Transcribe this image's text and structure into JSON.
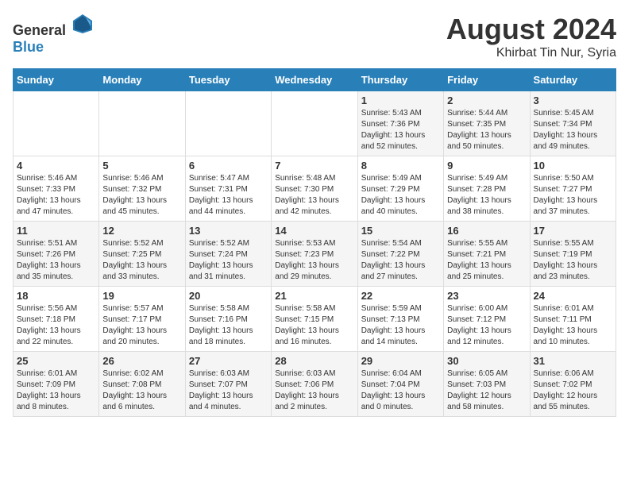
{
  "header": {
    "logo_general": "General",
    "logo_blue": "Blue",
    "title": "August 2024",
    "subtitle": "Khirbat Tin Nur, Syria"
  },
  "weekdays": [
    "Sunday",
    "Monday",
    "Tuesday",
    "Wednesday",
    "Thursday",
    "Friday",
    "Saturday"
  ],
  "weeks": [
    [
      {
        "day": "",
        "sunrise": "",
        "sunset": "",
        "daylight": ""
      },
      {
        "day": "",
        "sunrise": "",
        "sunset": "",
        "daylight": ""
      },
      {
        "day": "",
        "sunrise": "",
        "sunset": "",
        "daylight": ""
      },
      {
        "day": "",
        "sunrise": "",
        "sunset": "",
        "daylight": ""
      },
      {
        "day": "1",
        "sunrise": "Sunrise: 5:43 AM",
        "sunset": "Sunset: 7:36 PM",
        "daylight": "Daylight: 13 hours and 52 minutes."
      },
      {
        "day": "2",
        "sunrise": "Sunrise: 5:44 AM",
        "sunset": "Sunset: 7:35 PM",
        "daylight": "Daylight: 13 hours and 50 minutes."
      },
      {
        "day": "3",
        "sunrise": "Sunrise: 5:45 AM",
        "sunset": "Sunset: 7:34 PM",
        "daylight": "Daylight: 13 hours and 49 minutes."
      }
    ],
    [
      {
        "day": "4",
        "sunrise": "Sunrise: 5:46 AM",
        "sunset": "Sunset: 7:33 PM",
        "daylight": "Daylight: 13 hours and 47 minutes."
      },
      {
        "day": "5",
        "sunrise": "Sunrise: 5:46 AM",
        "sunset": "Sunset: 7:32 PM",
        "daylight": "Daylight: 13 hours and 45 minutes."
      },
      {
        "day": "6",
        "sunrise": "Sunrise: 5:47 AM",
        "sunset": "Sunset: 7:31 PM",
        "daylight": "Daylight: 13 hours and 44 minutes."
      },
      {
        "day": "7",
        "sunrise": "Sunrise: 5:48 AM",
        "sunset": "Sunset: 7:30 PM",
        "daylight": "Daylight: 13 hours and 42 minutes."
      },
      {
        "day": "8",
        "sunrise": "Sunrise: 5:49 AM",
        "sunset": "Sunset: 7:29 PM",
        "daylight": "Daylight: 13 hours and 40 minutes."
      },
      {
        "day": "9",
        "sunrise": "Sunrise: 5:49 AM",
        "sunset": "Sunset: 7:28 PM",
        "daylight": "Daylight: 13 hours and 38 minutes."
      },
      {
        "day": "10",
        "sunrise": "Sunrise: 5:50 AM",
        "sunset": "Sunset: 7:27 PM",
        "daylight": "Daylight: 13 hours and 37 minutes."
      }
    ],
    [
      {
        "day": "11",
        "sunrise": "Sunrise: 5:51 AM",
        "sunset": "Sunset: 7:26 PM",
        "daylight": "Daylight: 13 hours and 35 minutes."
      },
      {
        "day": "12",
        "sunrise": "Sunrise: 5:52 AM",
        "sunset": "Sunset: 7:25 PM",
        "daylight": "Daylight: 13 hours and 33 minutes."
      },
      {
        "day": "13",
        "sunrise": "Sunrise: 5:52 AM",
        "sunset": "Sunset: 7:24 PM",
        "daylight": "Daylight: 13 hours and 31 minutes."
      },
      {
        "day": "14",
        "sunrise": "Sunrise: 5:53 AM",
        "sunset": "Sunset: 7:23 PM",
        "daylight": "Daylight: 13 hours and 29 minutes."
      },
      {
        "day": "15",
        "sunrise": "Sunrise: 5:54 AM",
        "sunset": "Sunset: 7:22 PM",
        "daylight": "Daylight: 13 hours and 27 minutes."
      },
      {
        "day": "16",
        "sunrise": "Sunrise: 5:55 AM",
        "sunset": "Sunset: 7:21 PM",
        "daylight": "Daylight: 13 hours and 25 minutes."
      },
      {
        "day": "17",
        "sunrise": "Sunrise: 5:55 AM",
        "sunset": "Sunset: 7:19 PM",
        "daylight": "Daylight: 13 hours and 23 minutes."
      }
    ],
    [
      {
        "day": "18",
        "sunrise": "Sunrise: 5:56 AM",
        "sunset": "Sunset: 7:18 PM",
        "daylight": "Daylight: 13 hours and 22 minutes."
      },
      {
        "day": "19",
        "sunrise": "Sunrise: 5:57 AM",
        "sunset": "Sunset: 7:17 PM",
        "daylight": "Daylight: 13 hours and 20 minutes."
      },
      {
        "day": "20",
        "sunrise": "Sunrise: 5:58 AM",
        "sunset": "Sunset: 7:16 PM",
        "daylight": "Daylight: 13 hours and 18 minutes."
      },
      {
        "day": "21",
        "sunrise": "Sunrise: 5:58 AM",
        "sunset": "Sunset: 7:15 PM",
        "daylight": "Daylight: 13 hours and 16 minutes."
      },
      {
        "day": "22",
        "sunrise": "Sunrise: 5:59 AM",
        "sunset": "Sunset: 7:13 PM",
        "daylight": "Daylight: 13 hours and 14 minutes."
      },
      {
        "day": "23",
        "sunrise": "Sunrise: 6:00 AM",
        "sunset": "Sunset: 7:12 PM",
        "daylight": "Daylight: 13 hours and 12 minutes."
      },
      {
        "day": "24",
        "sunrise": "Sunrise: 6:01 AM",
        "sunset": "Sunset: 7:11 PM",
        "daylight": "Daylight: 13 hours and 10 minutes."
      }
    ],
    [
      {
        "day": "25",
        "sunrise": "Sunrise: 6:01 AM",
        "sunset": "Sunset: 7:09 PM",
        "daylight": "Daylight: 13 hours and 8 minutes."
      },
      {
        "day": "26",
        "sunrise": "Sunrise: 6:02 AM",
        "sunset": "Sunset: 7:08 PM",
        "daylight": "Daylight: 13 hours and 6 minutes."
      },
      {
        "day": "27",
        "sunrise": "Sunrise: 6:03 AM",
        "sunset": "Sunset: 7:07 PM",
        "daylight": "Daylight: 13 hours and 4 minutes."
      },
      {
        "day": "28",
        "sunrise": "Sunrise: 6:03 AM",
        "sunset": "Sunset: 7:06 PM",
        "daylight": "Daylight: 13 hours and 2 minutes."
      },
      {
        "day": "29",
        "sunrise": "Sunrise: 6:04 AM",
        "sunset": "Sunset: 7:04 PM",
        "daylight": "Daylight: 13 hours and 0 minutes."
      },
      {
        "day": "30",
        "sunrise": "Sunrise: 6:05 AM",
        "sunset": "Sunset: 7:03 PM",
        "daylight": "Daylight: 12 hours and 58 minutes."
      },
      {
        "day": "31",
        "sunrise": "Sunrise: 6:06 AM",
        "sunset": "Sunset: 7:02 PM",
        "daylight": "Daylight: 12 hours and 55 minutes."
      }
    ]
  ]
}
